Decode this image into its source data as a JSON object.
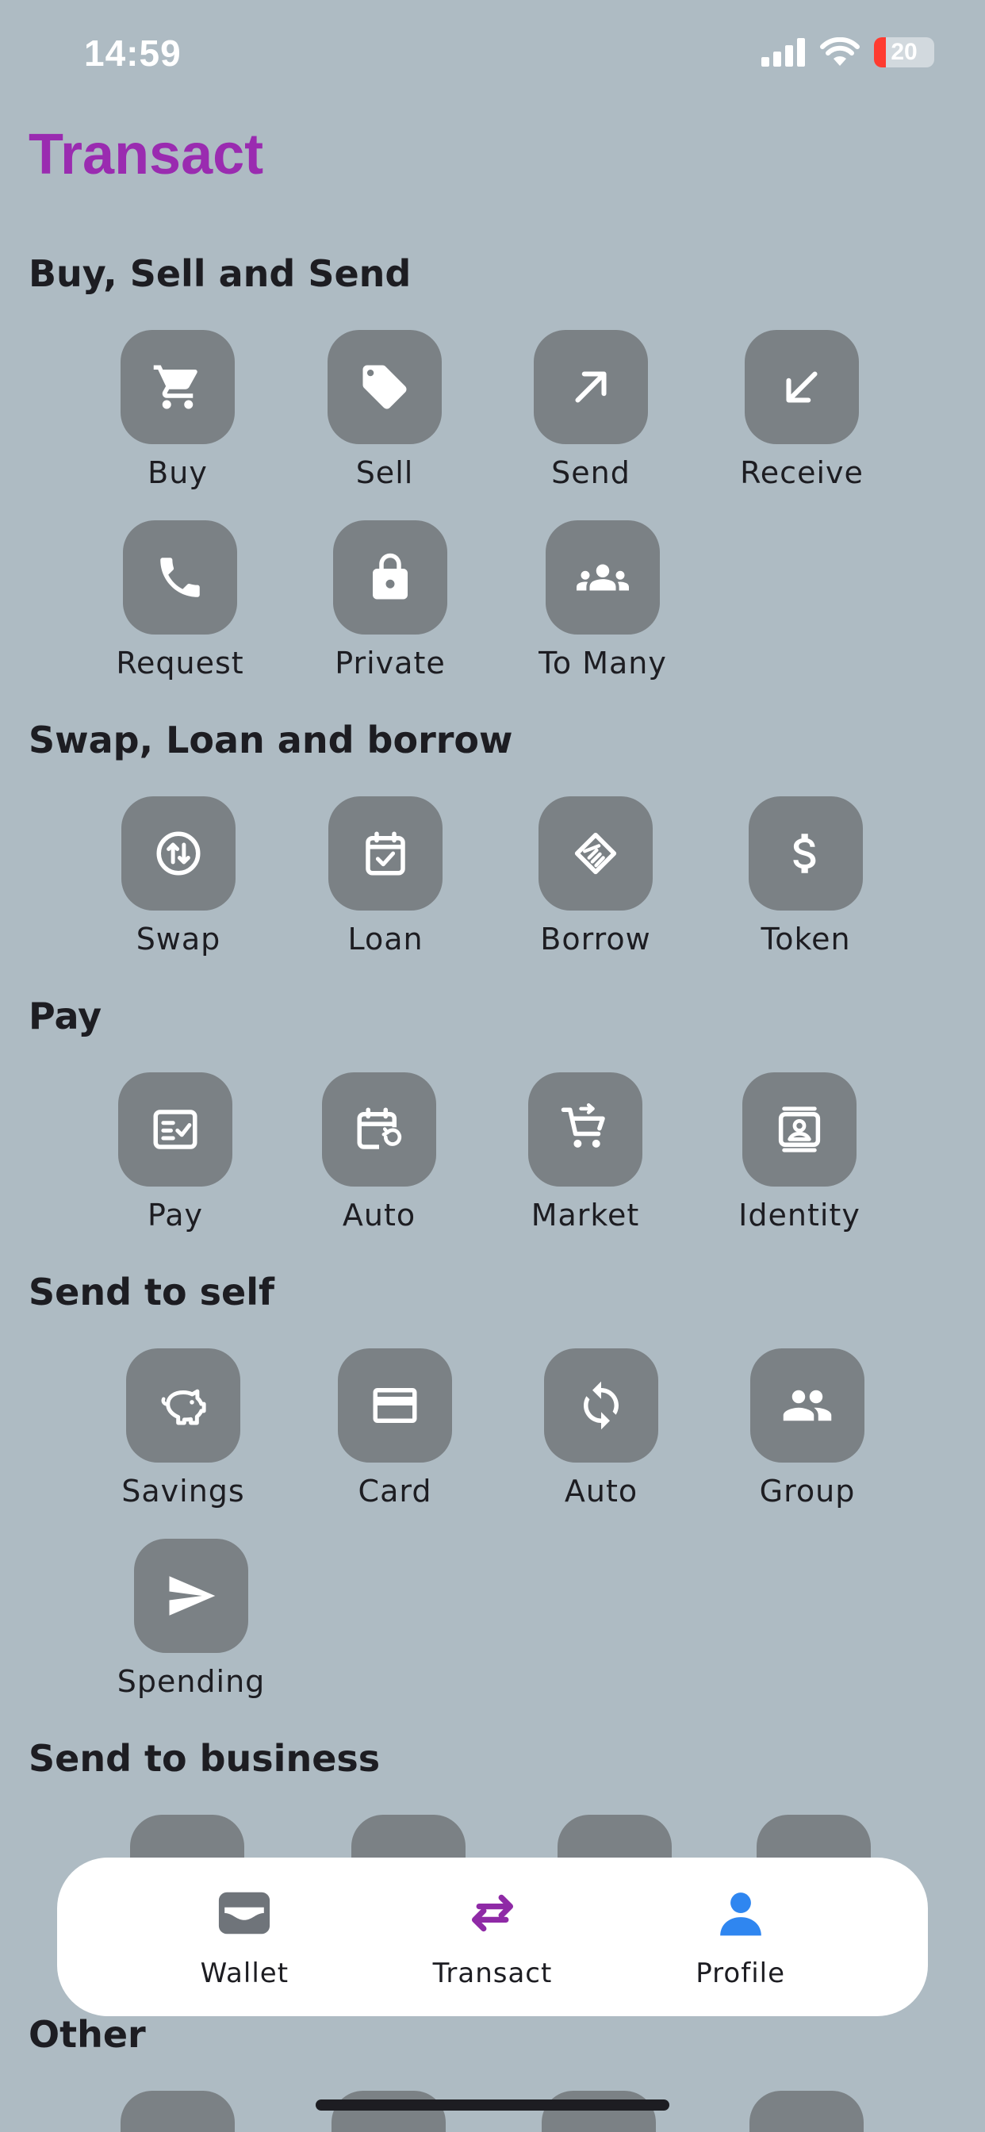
{
  "status_bar": {
    "time": "14:59",
    "battery": "20"
  },
  "page": {
    "title": "Transact"
  },
  "sections": {
    "buy_sell_send": {
      "title": "Buy, Sell and Send",
      "items": {
        "buy": "Buy",
        "sell": "Sell",
        "send": "Send",
        "receive": "Receive",
        "request": "Request",
        "private": "Private",
        "to_many": "To Many"
      }
    },
    "swap_loan": {
      "title": "Swap, Loan and borrow",
      "items": {
        "swap": "Swap",
        "loan": "Loan",
        "borrow": "Borrow",
        "token": "Token"
      }
    },
    "pay": {
      "title": "Pay",
      "items": {
        "pay": "Pay",
        "auto": "Auto",
        "market": "Market",
        "identity": "Identity"
      }
    },
    "send_to_self": {
      "title": "Send to self",
      "items": {
        "savings": "Savings",
        "card": "Card",
        "auto": "Auto",
        "group": "Group",
        "spending": "Spending"
      }
    },
    "send_to_business": {
      "title": "Send to business"
    },
    "other": {
      "title": "Other"
    }
  },
  "bottom_nav": {
    "wallet": "Wallet",
    "transact": "Transact",
    "profile": "Profile"
  },
  "icons": {
    "buy": "shopping-cart-icon",
    "sell": "tag-icon",
    "send": "arrow-up-right-icon",
    "receive": "arrow-down-left-icon",
    "request": "phone-icon",
    "private": "lock-icon",
    "to_many": "people-group-icon",
    "swap": "swap-vertical-circle-icon",
    "loan": "calendar-check-icon",
    "borrow": "handshake-icon",
    "token": "dollar-icon",
    "pay": "checklist-icon",
    "auto_pay": "calendar-repeat-icon",
    "market": "cart-arrow-icon",
    "identity": "contact-card-icon",
    "savings": "piggy-bank-icon",
    "card": "credit-card-icon",
    "auto_self": "refresh-icon",
    "group": "people-icon",
    "spending": "send-plane-icon",
    "nav_wallet": "wallet-icon",
    "nav_transact": "transfer-arrows-icon",
    "nav_profile": "person-icon"
  },
  "colors": {
    "background": "#aebbc3",
    "tile": "#7b8185",
    "title_purple": "#9a2bb0",
    "active_nav": "#8f2aa6",
    "profile_blue": "#2f86f0",
    "battery_low": "#ff3b30"
  }
}
